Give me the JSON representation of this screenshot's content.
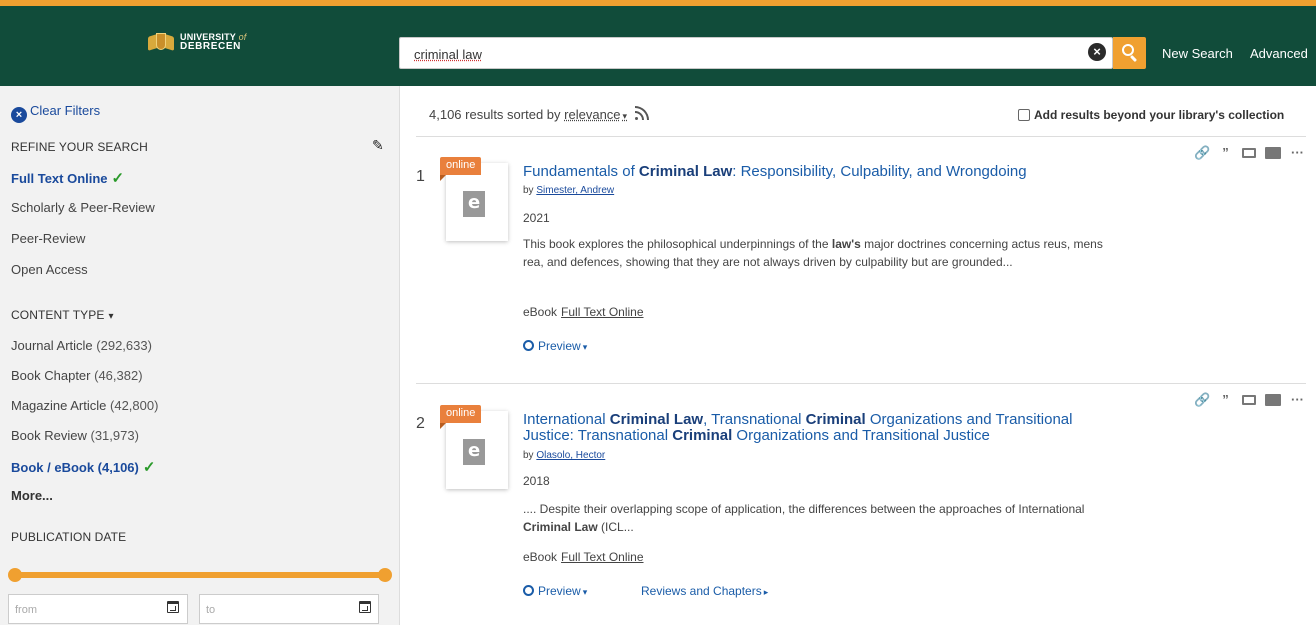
{
  "header": {
    "logo_line1": "UNIVERSITY",
    "logo_line1_of": "of",
    "logo_line2": "DEBRECEN",
    "search_value": "criminal law",
    "new_search": "New Search",
    "advanced": "Advanced"
  },
  "sidebar": {
    "clear_filters": "Clear Filters",
    "refine_heading": "REFINE YOUR SEARCH",
    "refine_items": [
      {
        "label": "Full Text Online",
        "selected": true
      },
      {
        "label": "Scholarly & Peer-Review",
        "selected": false
      },
      {
        "label": "Peer-Review",
        "selected": false
      },
      {
        "label": "Open Access",
        "selected": false
      }
    ],
    "content_type_heading": "CONTENT TYPE",
    "content_types": [
      {
        "label": "Journal Article",
        "count": "(292,633)",
        "selected": false
      },
      {
        "label": "Book Chapter",
        "count": "(46,382)",
        "selected": false
      },
      {
        "label": "Magazine Article",
        "count": "(42,800)",
        "selected": false
      },
      {
        "label": "Book Review",
        "count": "(31,973)",
        "selected": false
      },
      {
        "label": "Book / eBook (4,106)",
        "count": "",
        "selected": true
      }
    ],
    "more": "More...",
    "publication_date_heading": "PUBLICATION DATE",
    "date_from_placeholder": "from",
    "date_to_placeholder": "to"
  },
  "results_bar": {
    "count_text": "4,106 results sorted by",
    "sort_value": "relevance",
    "beyond_label": "Add results beyond your library's collection"
  },
  "results": [
    {
      "number": "1",
      "badge": "online",
      "title_parts": [
        {
          "text": "Fundamentals of ",
          "bold": false
        },
        {
          "text": "Criminal Law",
          "bold": true
        },
        {
          "text": ": Responsibility, Culpability, and Wrongdoing",
          "bold": false
        }
      ],
      "by": "by",
      "author": "Simester, Andrew",
      "year": "2021",
      "snippet_parts": [
        {
          "text": "This book explores the philosophical underpinnings of the ",
          "bold": false
        },
        {
          "text": "law's",
          "bold": true
        },
        {
          "text": " major doctrines concerning actus reus, mens rea, and defences, showing that they are not always driven by culpability but are grounded...",
          "bold": false
        }
      ],
      "format": "eBook",
      "full_text": "Full Text Online",
      "preview": "Preview",
      "reviews": ""
    },
    {
      "number": "2",
      "badge": "online",
      "title_parts": [
        {
          "text": "International ",
          "bold": false
        },
        {
          "text": "Criminal Law",
          "bold": true
        },
        {
          "text": ", Transnational ",
          "bold": false
        },
        {
          "text": "Criminal",
          "bold": true
        },
        {
          "text": " Organizations and Transitional Justice: Transnational ",
          "bold": false
        },
        {
          "text": "Criminal",
          "bold": true
        },
        {
          "text": " Organizations and Transitional Justice",
          "bold": false
        }
      ],
      "by": "by",
      "author": "Olasolo, Hector",
      "year": "2018",
      "snippet_parts": [
        {
          "text": ".... Despite their overlapping scope of application, the differences between the approaches of International ",
          "bold": false
        },
        {
          "text": "Criminal Law",
          "bold": true
        },
        {
          "text": " (ICL...",
          "bold": false
        }
      ],
      "format": "eBook",
      "full_text": "Full Text Online",
      "preview": "Preview",
      "reviews": "Reviews and Chapters"
    }
  ],
  "action_icons": [
    "link-icon",
    "quote-icon",
    "email-icon",
    "folder-add-icon",
    "more-icon"
  ],
  "colors": {
    "header_bg": "#114c3a",
    "accent": "#f0a030",
    "link": "#1a5ca8",
    "badge": "#e9803c",
    "check": "#2a9a2a"
  }
}
